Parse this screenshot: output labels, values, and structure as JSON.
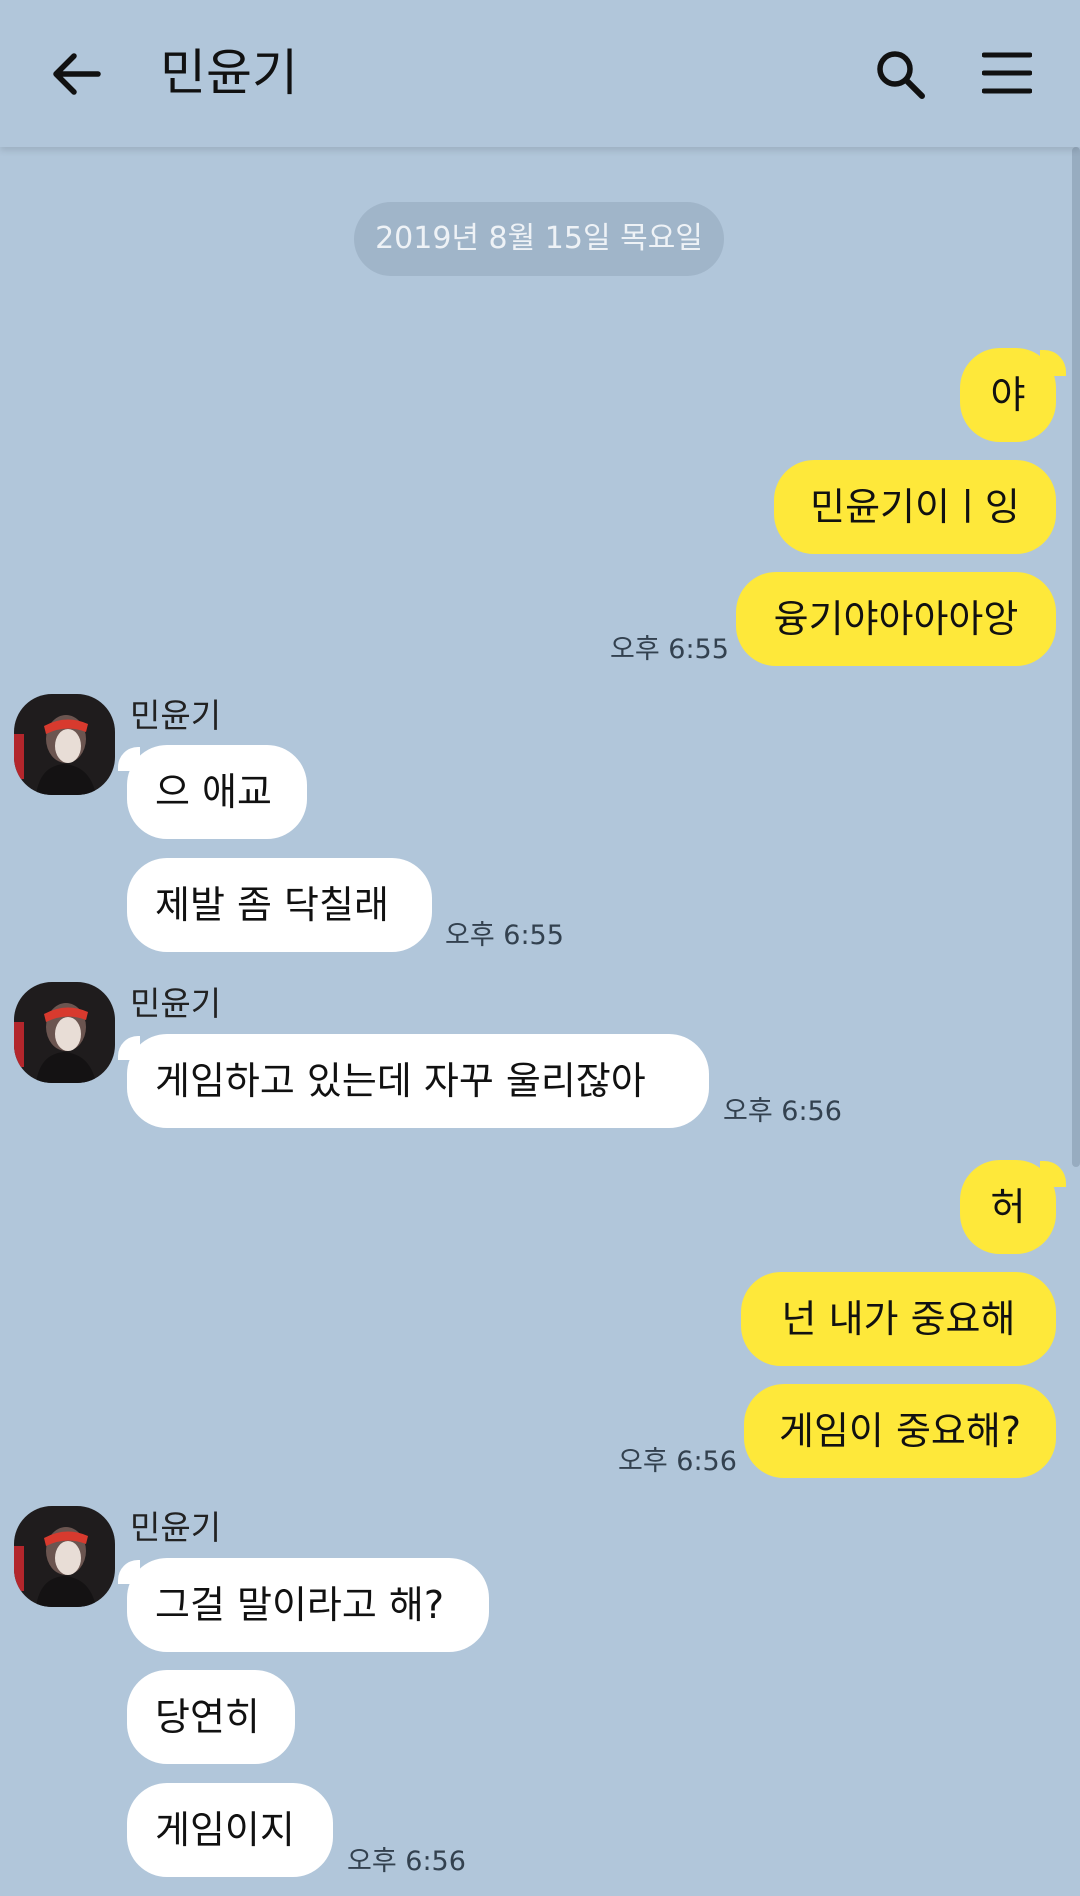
{
  "header": {
    "title": "민윤기",
    "back_icon": "arrow-left-icon",
    "search_icon": "search-icon",
    "menu_icon": "hamburger-menu-icon"
  },
  "date_divider": "2019년 8월 15일 목요일",
  "colors": {
    "background": "#b1c6da",
    "outgoing_bubble": "#fee83a",
    "incoming_bubble": "#ffffff"
  },
  "messages": {
    "out1": "야",
    "out2": "민윤기이ㅣ잉",
    "out3": "융기야아아아앙",
    "out_group1_time": "오후 6:55",
    "in_group1_sender": "민윤기",
    "in1": "으 애교",
    "in2": "제발 좀 닥칠래",
    "in_group1_time": "오후 6:55",
    "in_group2_sender": "민윤기",
    "in3": "게임하고 있는데 자꾸 울리잖아",
    "in_group2_time": "오후 6:56",
    "out4": "허",
    "out5": "넌 내가 중요해",
    "out6": "게임이 중요해?",
    "out_group2_time": "오후 6:56",
    "in_group3_sender": "민윤기",
    "in4": "그걸 말이라고 해?",
    "in5": "당연히",
    "in6": "게임이지",
    "in_group3_time": "오후 6:56"
  }
}
